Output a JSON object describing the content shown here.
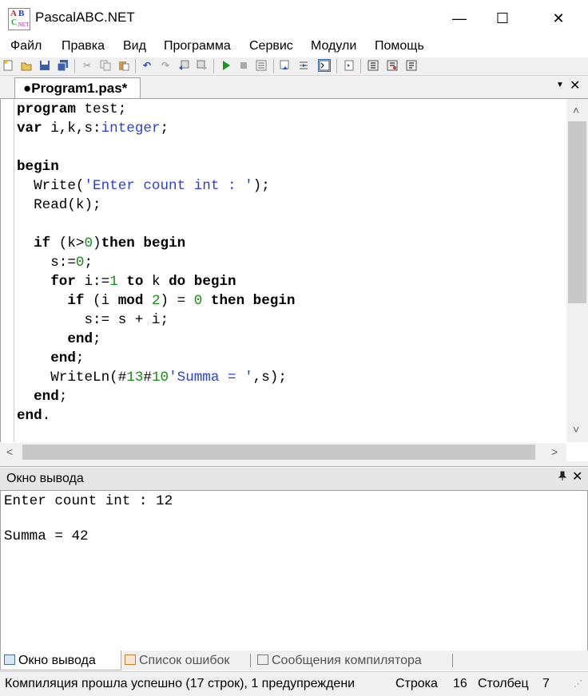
{
  "window": {
    "title": "PascalABC.NET",
    "minimize": "—",
    "maximize": "☐",
    "close": "✕"
  },
  "menu": [
    "Файл",
    "Правка",
    "Вид",
    "Программа",
    "Сервис",
    "Модули",
    "Помощь"
  ],
  "toolbar": {
    "icons": [
      "new-file-icon",
      "open-folder-icon",
      "save-icon",
      "save-all-icon",
      "cut-icon",
      "copy-icon",
      "paste-icon",
      "undo-icon",
      "redo-icon",
      "navigate-back-icon",
      "navigate-forward-icon",
      "run-icon",
      "stop-icon",
      "compile-icon",
      "step-over-icon",
      "step-into-icon",
      "console-toggle-icon",
      "output-icon",
      "format-code-icon",
      "debug-watch-icon",
      "debug-locals-icon"
    ]
  },
  "editor_tab": {
    "label": "●Program1.pas*",
    "dropdown": "▼",
    "close": "✕"
  },
  "code_lines": [
    [
      {
        "t": "program",
        "k": "kw"
      },
      {
        "t": " test;",
        "k": ""
      }
    ],
    [
      {
        "t": "var",
        "k": "kw"
      },
      {
        "t": " i,k,s:",
        "k": ""
      },
      {
        "t": "integer",
        "k": "ty"
      },
      {
        "t": ";",
        "k": ""
      }
    ],
    [],
    [
      {
        "t": "begin",
        "k": "kw"
      }
    ],
    [
      {
        "t": "  Write(",
        "k": ""
      },
      {
        "t": "'Enter count int : '",
        "k": "str"
      },
      {
        "t": ");",
        "k": ""
      }
    ],
    [
      {
        "t": "  Read(k);",
        "k": ""
      }
    ],
    [],
    [
      {
        "t": "  ",
        "k": ""
      },
      {
        "t": "if",
        "k": "kw"
      },
      {
        "t": " (k>",
        "k": ""
      },
      {
        "t": "0",
        "k": "num"
      },
      {
        "t": ")",
        "k": ""
      },
      {
        "t": "then begin",
        "k": "kw"
      }
    ],
    [
      {
        "t": "    s:=",
        "k": ""
      },
      {
        "t": "0",
        "k": "num"
      },
      {
        "t": ";",
        "k": ""
      }
    ],
    [
      {
        "t": "    ",
        "k": ""
      },
      {
        "t": "for",
        "k": "kw"
      },
      {
        "t": " i:=",
        "k": ""
      },
      {
        "t": "1",
        "k": "num"
      },
      {
        "t": " ",
        "k": ""
      },
      {
        "t": "to",
        "k": "kw"
      },
      {
        "t": " k ",
        "k": ""
      },
      {
        "t": "do begin",
        "k": "kw"
      }
    ],
    [
      {
        "t": "      ",
        "k": ""
      },
      {
        "t": "if",
        "k": "kw"
      },
      {
        "t": " (i ",
        "k": ""
      },
      {
        "t": "mod",
        "k": "kw"
      },
      {
        "t": " ",
        "k": ""
      },
      {
        "t": "2",
        "k": "num"
      },
      {
        "t": ") = ",
        "k": ""
      },
      {
        "t": "0",
        "k": "num"
      },
      {
        "t": " ",
        "k": ""
      },
      {
        "t": "then begin",
        "k": "kw"
      }
    ],
    [
      {
        "t": "        s:= s + i;",
        "k": ""
      }
    ],
    [
      {
        "t": "      ",
        "k": ""
      },
      {
        "t": "end",
        "k": "kw"
      },
      {
        "t": ";",
        "k": ""
      }
    ],
    [
      {
        "t": "    ",
        "k": ""
      },
      {
        "t": "end",
        "k": "kw"
      },
      {
        "t": ";",
        "k": ""
      }
    ],
    [
      {
        "t": "    WriteLn(#",
        "k": ""
      },
      {
        "t": "13",
        "k": "num"
      },
      {
        "t": "#",
        "k": ""
      },
      {
        "t": "10",
        "k": "num"
      },
      {
        "t": "'Summa = '",
        "k": "str"
      },
      {
        "t": ",s);",
        "k": ""
      }
    ],
    [
      {
        "t": "  ",
        "k": ""
      },
      {
        "t": "end",
        "k": "kw"
      },
      {
        "t": ";",
        "k": ""
      }
    ],
    [
      {
        "t": "end",
        "k": "kw"
      },
      {
        "t": ".",
        "k": ""
      }
    ]
  ],
  "colors": {
    "keyword": "#000000",
    "type": "#2b3fd8",
    "string": "#2b3fd8",
    "number": "#1a8a1a"
  },
  "output_panel": {
    "title": "Окно вывода",
    "pin": "📌",
    "close": "✕",
    "lines": [
      "Enter count int : 12",
      "",
      "Summa = 42"
    ]
  },
  "bottom_tabs": [
    "Окно вывода",
    "Список ошибок",
    "Сообщения компилятора"
  ],
  "status": {
    "message": "Компиляция прошла успешно (17 строк), 1 предупреждени",
    "line_label": "Строка",
    "line_value": "16",
    "col_label": "Столбец",
    "col_value": "7"
  },
  "scrollbars": {
    "up": "˄",
    "down": "˅",
    "left": "<",
    "right": ">"
  }
}
